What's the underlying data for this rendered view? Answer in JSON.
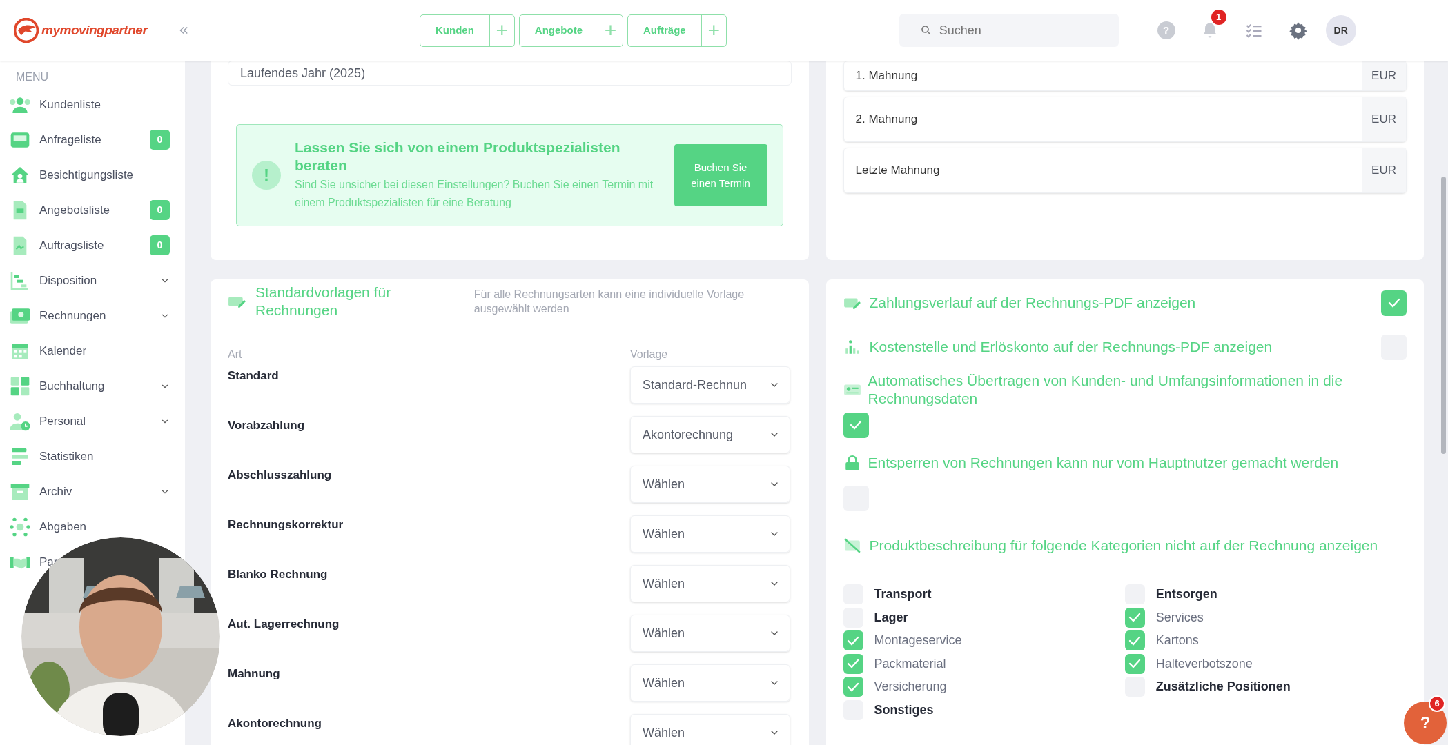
{
  "logo": {
    "text": "mymovingpartner"
  },
  "topbar": {
    "quick_create": [
      {
        "label": "Kunden",
        "add": "+"
      },
      {
        "label": "Angebote",
        "add": "+"
      },
      {
        "label": "Aufträge",
        "add": "+"
      }
    ],
    "search": {
      "placeholder": "Suchen"
    },
    "help": "?",
    "notifications": "1",
    "avatar": "DR"
  },
  "sidebar": {
    "menu_label": "MENU",
    "items": [
      {
        "label": "Kundenliste",
        "expandable": false
      },
      {
        "label": "Anfrageliste",
        "badge": "0",
        "expandable": false
      },
      {
        "label": "Besichtigungsliste",
        "expandable": false
      },
      {
        "label": "Angebotsliste",
        "badge": "0",
        "expandable": false
      },
      {
        "label": "Auftragsliste",
        "badge": "0",
        "expandable": false
      },
      {
        "label": "Disposition",
        "expandable": true
      },
      {
        "label": "Rechnungen",
        "expandable": true
      },
      {
        "label": "Kalender",
        "expandable": false
      },
      {
        "label": "Buchhaltung",
        "expandable": true
      },
      {
        "label": "Personal",
        "expandable": true
      },
      {
        "label": "Statistiken",
        "expandable": false
      },
      {
        "label": "Archiv",
        "expandable": true
      },
      {
        "label": "Abgaben",
        "expandable": false
      },
      {
        "label": "Par",
        "expandable": false
      }
    ]
  },
  "period_field": {
    "value": "Laufendes Jahr (2025)"
  },
  "consultation": {
    "icon": "!",
    "title": "Lassen Sie sich von einem Produktspezialisten beraten",
    "text": "Sind Sie unsicher bei diesen Einstellungen? Buchen Sie einen Termin mit einem Produktspezialisten für eine Beratung",
    "button": "Buchen Sie einen Termin"
  },
  "dunning_fees": [
    {
      "label": "1. Mahnung",
      "unit": "EUR"
    },
    {
      "label": "2. Mahnung",
      "unit": "EUR"
    },
    {
      "label": "Letzte Mahnung",
      "unit": "EUR"
    }
  ],
  "templates": {
    "title": "Standardvorlagen für Rechnungen",
    "description": "Für alle Rechnungsarten kann eine individuelle Vorlage ausgewählt werden",
    "columns": [
      "Art",
      "Vorlage"
    ],
    "rows": [
      {
        "type": "Standard",
        "template": "Standard-Rechnun"
      },
      {
        "type": "Vorabzahlung",
        "template": "Akontorechnung"
      },
      {
        "type": "Abschlusszahlung",
        "template": "Wählen"
      },
      {
        "type": "Rechnungskorrektur",
        "template": "Wählen"
      },
      {
        "type": "Blanko Rechnung",
        "template": "Wählen"
      },
      {
        "type": "Aut. Lagerrechnung",
        "template": "Wählen"
      },
      {
        "type": "Mahnung",
        "template": "Wählen"
      },
      {
        "type": "Akontorechnung",
        "template": "Wählen"
      }
    ]
  },
  "settings": [
    {
      "kind": "inline",
      "label": "Zahlungsverlauf auf der Rechnungs-PDF anzeigen",
      "checked": true
    },
    {
      "kind": "inline",
      "label": "Kostenstelle und Erlöskonto auf der Rechnungs-PDF anzeigen",
      "checked": false
    },
    {
      "kind": "below",
      "label": "Automatisches Übertragen von Kunden- und Umfangsinformationen in die Rechnungsdaten",
      "checked": true
    },
    {
      "kind": "below",
      "label": "Entsperren von Rechnungen kann nur vom Hauptnutzer gemacht werden",
      "checked": false
    },
    {
      "kind": "heading",
      "label": "Produktbeschreibung für folgende Kategorien nicht auf der Rechnung anzeigen"
    }
  ],
  "categories": [
    {
      "items": [
        {
          "label": "Transport",
          "checked": false
        },
        {
          "label": "Lager",
          "checked": false
        },
        {
          "label": "Montageservice",
          "checked": true
        },
        {
          "label": "Packmaterial",
          "checked": true
        },
        {
          "label": "Versicherung",
          "checked": true
        },
        {
          "label": "Sonstiges",
          "checked": false
        }
      ]
    },
    {
      "items": [
        {
          "label": "Entsorgen",
          "checked": false
        },
        {
          "label": "Services",
          "checked": true
        },
        {
          "label": "Kartons",
          "checked": true
        },
        {
          "label": "Halteverbotszone",
          "checked": true
        },
        {
          "label": "Zusätzliche Positionen",
          "checked": false
        }
      ]
    }
  ],
  "help_button": {
    "label": "?",
    "badge": "6"
  }
}
